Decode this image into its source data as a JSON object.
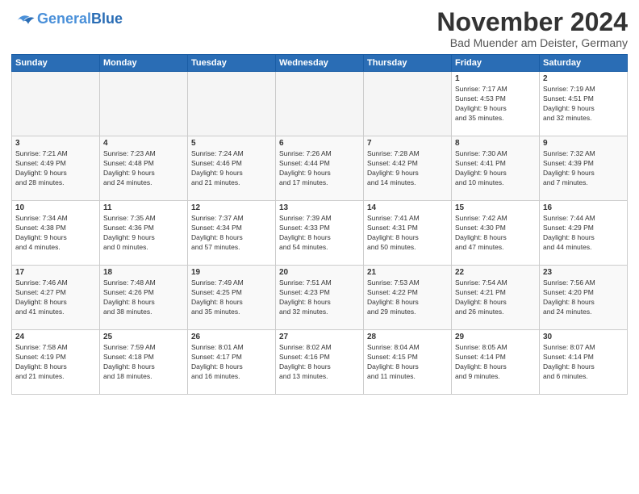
{
  "logo": {
    "general": "General",
    "blue": "Blue"
  },
  "title": "November 2024",
  "location": "Bad Muender am Deister, Germany",
  "weekdays": [
    "Sunday",
    "Monday",
    "Tuesday",
    "Wednesday",
    "Thursday",
    "Friday",
    "Saturday"
  ],
  "weeks": [
    [
      {
        "day": "",
        "info": ""
      },
      {
        "day": "",
        "info": ""
      },
      {
        "day": "",
        "info": ""
      },
      {
        "day": "",
        "info": ""
      },
      {
        "day": "",
        "info": ""
      },
      {
        "day": "1",
        "info": "Sunrise: 7:17 AM\nSunset: 4:53 PM\nDaylight: 9 hours\nand 35 minutes."
      },
      {
        "day": "2",
        "info": "Sunrise: 7:19 AM\nSunset: 4:51 PM\nDaylight: 9 hours\nand 32 minutes."
      }
    ],
    [
      {
        "day": "3",
        "info": "Sunrise: 7:21 AM\nSunset: 4:49 PM\nDaylight: 9 hours\nand 28 minutes."
      },
      {
        "day": "4",
        "info": "Sunrise: 7:23 AM\nSunset: 4:48 PM\nDaylight: 9 hours\nand 24 minutes."
      },
      {
        "day": "5",
        "info": "Sunrise: 7:24 AM\nSunset: 4:46 PM\nDaylight: 9 hours\nand 21 minutes."
      },
      {
        "day": "6",
        "info": "Sunrise: 7:26 AM\nSunset: 4:44 PM\nDaylight: 9 hours\nand 17 minutes."
      },
      {
        "day": "7",
        "info": "Sunrise: 7:28 AM\nSunset: 4:42 PM\nDaylight: 9 hours\nand 14 minutes."
      },
      {
        "day": "8",
        "info": "Sunrise: 7:30 AM\nSunset: 4:41 PM\nDaylight: 9 hours\nand 10 minutes."
      },
      {
        "day": "9",
        "info": "Sunrise: 7:32 AM\nSunset: 4:39 PM\nDaylight: 9 hours\nand 7 minutes."
      }
    ],
    [
      {
        "day": "10",
        "info": "Sunrise: 7:34 AM\nSunset: 4:38 PM\nDaylight: 9 hours\nand 4 minutes."
      },
      {
        "day": "11",
        "info": "Sunrise: 7:35 AM\nSunset: 4:36 PM\nDaylight: 9 hours\nand 0 minutes."
      },
      {
        "day": "12",
        "info": "Sunrise: 7:37 AM\nSunset: 4:34 PM\nDaylight: 8 hours\nand 57 minutes."
      },
      {
        "day": "13",
        "info": "Sunrise: 7:39 AM\nSunset: 4:33 PM\nDaylight: 8 hours\nand 54 minutes."
      },
      {
        "day": "14",
        "info": "Sunrise: 7:41 AM\nSunset: 4:31 PM\nDaylight: 8 hours\nand 50 minutes."
      },
      {
        "day": "15",
        "info": "Sunrise: 7:42 AM\nSunset: 4:30 PM\nDaylight: 8 hours\nand 47 minutes."
      },
      {
        "day": "16",
        "info": "Sunrise: 7:44 AM\nSunset: 4:29 PM\nDaylight: 8 hours\nand 44 minutes."
      }
    ],
    [
      {
        "day": "17",
        "info": "Sunrise: 7:46 AM\nSunset: 4:27 PM\nDaylight: 8 hours\nand 41 minutes."
      },
      {
        "day": "18",
        "info": "Sunrise: 7:48 AM\nSunset: 4:26 PM\nDaylight: 8 hours\nand 38 minutes."
      },
      {
        "day": "19",
        "info": "Sunrise: 7:49 AM\nSunset: 4:25 PM\nDaylight: 8 hours\nand 35 minutes."
      },
      {
        "day": "20",
        "info": "Sunrise: 7:51 AM\nSunset: 4:23 PM\nDaylight: 8 hours\nand 32 minutes."
      },
      {
        "day": "21",
        "info": "Sunrise: 7:53 AM\nSunset: 4:22 PM\nDaylight: 8 hours\nand 29 minutes."
      },
      {
        "day": "22",
        "info": "Sunrise: 7:54 AM\nSunset: 4:21 PM\nDaylight: 8 hours\nand 26 minutes."
      },
      {
        "day": "23",
        "info": "Sunrise: 7:56 AM\nSunset: 4:20 PM\nDaylight: 8 hours\nand 24 minutes."
      }
    ],
    [
      {
        "day": "24",
        "info": "Sunrise: 7:58 AM\nSunset: 4:19 PM\nDaylight: 8 hours\nand 21 minutes."
      },
      {
        "day": "25",
        "info": "Sunrise: 7:59 AM\nSunset: 4:18 PM\nDaylight: 8 hours\nand 18 minutes."
      },
      {
        "day": "26",
        "info": "Sunrise: 8:01 AM\nSunset: 4:17 PM\nDaylight: 8 hours\nand 16 minutes."
      },
      {
        "day": "27",
        "info": "Sunrise: 8:02 AM\nSunset: 4:16 PM\nDaylight: 8 hours\nand 13 minutes."
      },
      {
        "day": "28",
        "info": "Sunrise: 8:04 AM\nSunset: 4:15 PM\nDaylight: 8 hours\nand 11 minutes."
      },
      {
        "day": "29",
        "info": "Sunrise: 8:05 AM\nSunset: 4:14 PM\nDaylight: 8 hours\nand 9 minutes."
      },
      {
        "day": "30",
        "info": "Sunrise: 8:07 AM\nSunset: 4:14 PM\nDaylight: 8 hours\nand 6 minutes."
      }
    ]
  ]
}
